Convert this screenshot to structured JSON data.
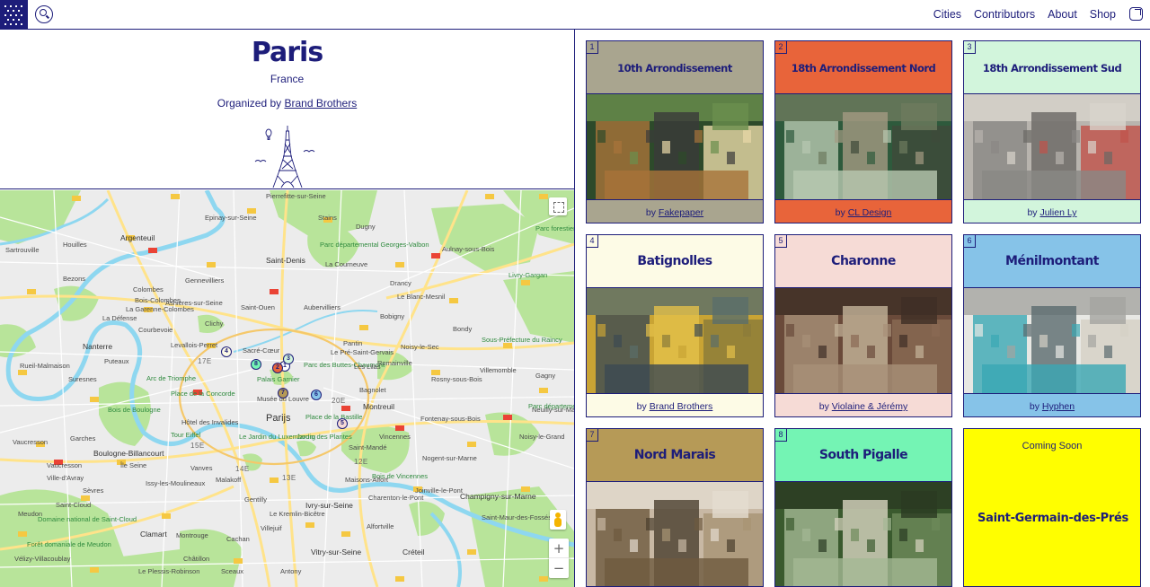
{
  "nav": {
    "items": [
      "Cities",
      "Contributors",
      "About",
      "Shop"
    ]
  },
  "city": {
    "name": "Paris",
    "country": "France",
    "organized_prefix": "Organized by",
    "organizer": "Brand Brothers"
  },
  "map": {
    "labels": {
      "argenteuil": "Argenteuil",
      "saint_denis": "Saint-Denis",
      "nanterre": "Nanterre",
      "paris": "Parijs",
      "boulogne": "Boulogne-Billancourt",
      "vincennes": "Vincennes",
      "montreuil": "Montreuil",
      "creteil": "Créteil",
      "clamart": "Clamart",
      "bobigny": "Bobigny",
      "aubervilliers": "Aubervilliers",
      "pantin": "Pantin",
      "drancy": "Drancy",
      "courbevoie": "Courbevoie",
      "levallois": "Levallois-Perret",
      "clichy": "Clichy",
      "colombes": "Colombes",
      "sartrouville": "Sartrouville",
      "rueil": "Rueil-Malmaison",
      "issy": "Issy-les-Moulineaux",
      "vanves": "Vanves",
      "malakoff": "Malakoff",
      "ivry": "Ivry-sur-Seine",
      "vitry": "Vitry-sur-Seine",
      "champigny": "Champigny-sur-Marne",
      "rosny": "Rosny-sous-Bois",
      "bagnolet": "Bagnolet",
      "noisy": "Noisy-le-Sec",
      "epinay": "Epinay-sur-Seine",
      "pierrefitte": "Pierrefitte-sur-Seine",
      "stains": "Stains",
      "dugny": "Dugny",
      "aulnay": "Aulnay-sous-Bois",
      "livry": "Livry-Gargan",
      "villemomble": "Villemomble",
      "gagny": "Gagny",
      "neuilly_marne": "Neuilly-sur-Marne",
      "noisy_grand": "Noisy-le-Grand",
      "nogent": "Nogent-sur-Marne",
      "joinville": "Joinville-le-Pont",
      "saint_maur": "Saint-Maur-des-Fossés",
      "charenton": "Charenton-le-Pont",
      "alfortville": "Alfortville",
      "sceaux": "Sceaux",
      "antony": "Antony",
      "meudon": "Meudon",
      "sevres": "Sèvres",
      "ville_avray": "Ville-d'Avray",
      "vaucresson": "Vaucresson",
      "garches": "Garches",
      "saint_cloud": "Saint-Cloud",
      "suresnes": "Suresnes",
      "puteaux": "Puteaux",
      "velizy": "Vélizy-Villacoublay",
      "plessis": "Le Plessis-Robinson",
      "chatillon": "Châtillon",
      "montrouge": "Montrouge",
      "bezons": "Bezons",
      "houilles": "Houilles",
      "gennevilliers": "Gennevilliers",
      "asnieres": "Asnières-sur-Seine",
      "garenne": "La Garenne-Colombes",
      "bois_colombes": "Bois-Colombes",
      "bois_boulogne": "Bois de Boulogne",
      "bois_vincennes": "Bois de Vincennes",
      "parc_buttes": "Parc des Buttes-Chaumont",
      "parc_dept": "Parc départemental Georges-Valbon",
      "arc_triomphe": "Arc de Triomphe",
      "tour_eiffel": "Tour Eiffel",
      "hotel_invalides": "Hôtel des Invalides",
      "jardin_lux": "Le Jardin du Luxembourg",
      "jardin_plantes": "Jardin des Plantes",
      "place_concorde": "Place de la Concorde",
      "place_bastille": "Place de la Bastille",
      "palais_garnier": "Palais Garnier",
      "musee_louvre": "Musée du Louvre",
      "sacre_coeur": "Sacré-Cœur",
      "arr_17": "17E",
      "arr_20": "20E",
      "arr_15": "15E",
      "arr_14": "14E",
      "arr_13": "13E",
      "arr_12": "12E",
      "la_courneuve": "La Courneuve",
      "le_blanc": "Le Blanc-Mesnil",
      "bondy": "Bondy",
      "les_lilas": "Les Lilas",
      "romainville": "Romainville",
      "saint_mande": "Saint-Mandé",
      "maisons": "Maisons-Alfort",
      "saint_ouen": "Saint-Ouen",
      "la_defense": "La Défense",
      "fontenay": "Fontenay-sous-Bois",
      "le_pre": "Le Pré-Saint-Gervais",
      "villejuif": "Villejuif",
      "kremlin": "Le Kremlin-Bicêtre",
      "gentilly": "Gentilly",
      "cachan": "Cachan",
      "vauxresson_label": "Vaucresson",
      "parc_forestier": "Parc forestier",
      "sous_prefecture": "Sous-Préfecture du Raincy",
      "parc_dept_2": "Parc départemental",
      "saint_cloud_park": "Domaine national de Saint-Cloud",
      "foret_meudon": "Forêt domaniale de Meudon",
      "ile_seine": "Île Seine"
    },
    "pins": [
      "1",
      "2",
      "3",
      "4",
      "5",
      "6",
      "7",
      "8"
    ]
  },
  "neighborhoods": [
    {
      "num": "1",
      "title": "10th Arrondissement",
      "by_prefix": "by",
      "author": "Fakepaper",
      "color": "#a9a58f"
    },
    {
      "num": "2",
      "title": "18th Arrondissement Nord",
      "by_prefix": "by",
      "author": "CL Design",
      "color": "#e8643a"
    },
    {
      "num": "3",
      "title": "18th Arrondissement Sud",
      "by_prefix": "by",
      "author": "Julien Ly",
      "color": "#d2f5dc"
    },
    {
      "num": "4",
      "title": "Batignolles",
      "by_prefix": "by",
      "author": "Brand Brothers",
      "color": "#fdfbe6"
    },
    {
      "num": "5",
      "title": "Charonne",
      "by_prefix": "by",
      "author": "Violaine & Jérémy",
      "color": "#f6dbd6"
    },
    {
      "num": "6",
      "title": "Ménilmontant",
      "by_prefix": "by",
      "author": "Hyphen",
      "color": "#86c3e8"
    },
    {
      "num": "7",
      "title": "Nord Marais",
      "color": "#b69a57"
    },
    {
      "num": "8",
      "title": "South Pigalle",
      "color": "#74f4b4"
    }
  ],
  "coming_soon": {
    "label": "Coming Soon",
    "title": "Saint-Germain-des-Prés",
    "color": "#fffe00"
  },
  "colors": {
    "brand_navy": "#1d1d7a",
    "map_water": "#8ed7f0",
    "map_park": "#b8e49a",
    "map_urban": "#ececec",
    "map_road_yellow": "#ffe38a"
  }
}
